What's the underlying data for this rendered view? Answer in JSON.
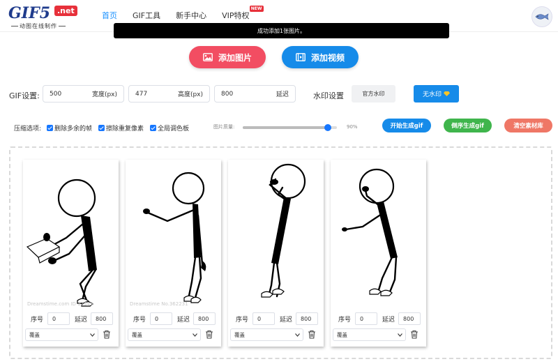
{
  "header": {
    "logo_main": "GIF5",
    "logo_net": ".net",
    "logo_sub": "动图在线制作",
    "nav": [
      {
        "label": "首页",
        "active": true
      },
      {
        "label": "GIF工具",
        "active": false
      },
      {
        "label": "新手中心",
        "active": false
      },
      {
        "label": "VIP特权",
        "active": false,
        "badge": "NEW"
      }
    ]
  },
  "toast": "成功添加1张图片。",
  "actions": {
    "add_image": "添加图片",
    "add_video": "添加视频"
  },
  "gif_settings": {
    "label": "GIF设置:",
    "width": {
      "value": "500",
      "unit": "宽度(px)"
    },
    "height": {
      "value": "477",
      "unit": "高度(px)"
    },
    "delay": {
      "value": "800",
      "unit": "延迟"
    }
  },
  "watermark": {
    "label": "水印设置",
    "official": "官方水印",
    "none": "无水印"
  },
  "compression": {
    "label": "压缩选项:",
    "options": [
      {
        "label": "删除多余的帧",
        "checked": true
      },
      {
        "label": "擦除重复像素",
        "checked": true
      },
      {
        "label": "全局调色板",
        "checked": true
      }
    ],
    "quality_label": "图片质量:",
    "quality_value": "90%",
    "quality_fraction": 0.9
  },
  "buttons": {
    "start": "开始生成gif",
    "order": "倒序生成gif",
    "clear": "清空素材库"
  },
  "frames": [
    {
      "seq_label": "序号",
      "seq": "0",
      "delay_label": "延迟",
      "delay": "800",
      "mode": "覆盖",
      "watermark": "Dreamstime.com  ID 12345"
    },
    {
      "seq_label": "序号",
      "seq": "0",
      "delay_label": "延迟",
      "delay": "800",
      "mode": "覆盖",
      "watermark": "Dreamstime  No.362231"
    },
    {
      "seq_label": "序号",
      "seq": "0",
      "delay_label": "延迟",
      "delay": "800",
      "mode": "覆盖",
      "watermark": ""
    },
    {
      "seq_label": "序号",
      "seq": "0",
      "delay_label": "延迟",
      "delay": "800",
      "mode": "覆盖",
      "watermark": ""
    }
  ],
  "colors": {
    "primary": "#168be9",
    "red": "#f24d62",
    "green": "#3fb54c",
    "coral": "#ef7766"
  }
}
